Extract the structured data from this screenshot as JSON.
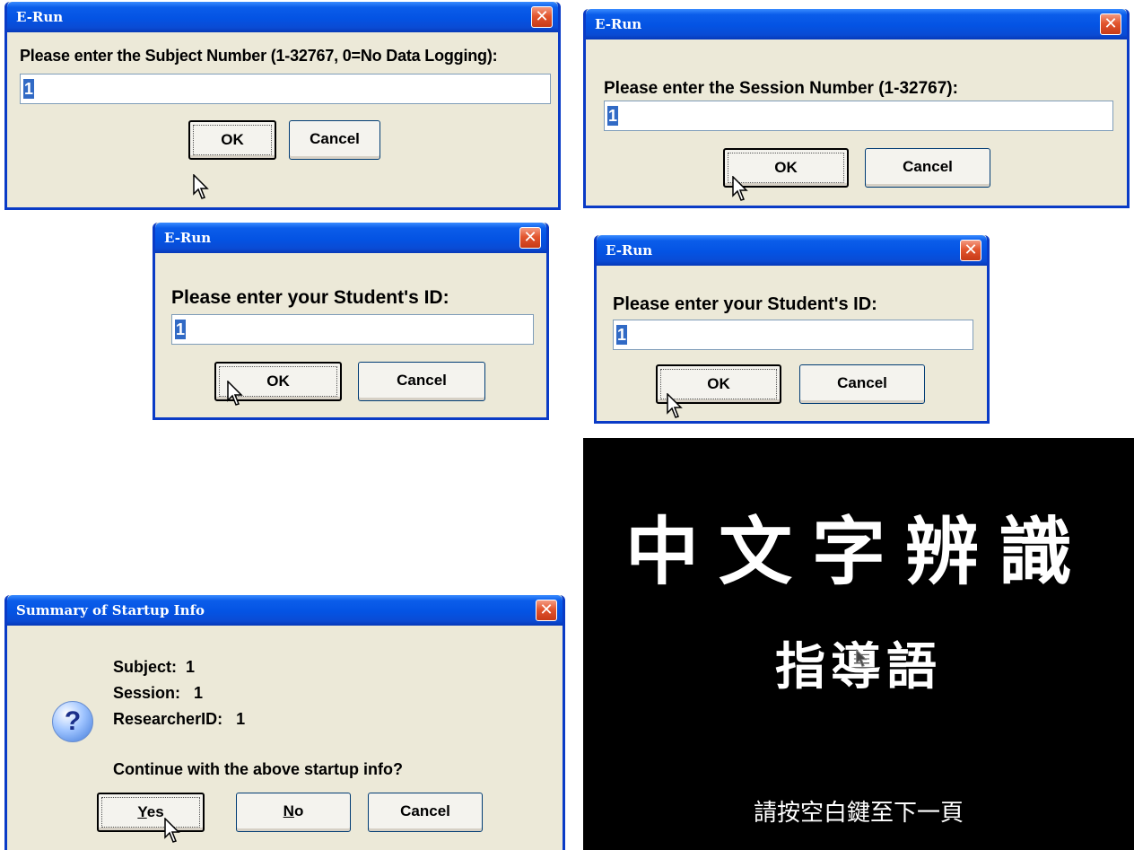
{
  "dialog_subject": {
    "title": "E-Run",
    "prompt": "Please enter the Subject Number (1-32767, 0=No Data Logging):",
    "value": "1",
    "ok": "OK",
    "cancel": "Cancel"
  },
  "dialog_session": {
    "title": "E-Run",
    "prompt": "Please enter the Session Number (1-32767):",
    "value": "1",
    "ok": "OK",
    "cancel": "Cancel"
  },
  "dialog_student_left": {
    "title": "E-Run",
    "prompt": "Please enter your Student's ID:",
    "value": "1",
    "ok": "OK",
    "cancel": "Cancel"
  },
  "dialog_student_right": {
    "title": "E-Run",
    "prompt": "Please enter your Student's ID:",
    "value": "1",
    "ok": "OK",
    "cancel": "Cancel"
  },
  "summary": {
    "title": "Summary of Startup Info",
    "subject_label": "Subject:",
    "subject_value": "1",
    "session_label": "Session:",
    "session_value": "1",
    "researcher_label": "ResearcherID:",
    "researcher_value": "1",
    "question": "Continue with the above startup info?",
    "yes_first": "Y",
    "yes_rest": "es",
    "no_first": "N",
    "no_rest": "o",
    "cancel": "Cancel",
    "icon": "question-icon"
  },
  "instruction_screen": {
    "title": "中文字辨識",
    "subtitle": "指導語",
    "hint": "請按空白鍵至下一頁",
    "background": "#000000"
  },
  "colors": {
    "titlebar": "#0453e3",
    "dialog_bg": "#ece9d8",
    "close": "#e2552e",
    "selection": "#316ac5"
  }
}
